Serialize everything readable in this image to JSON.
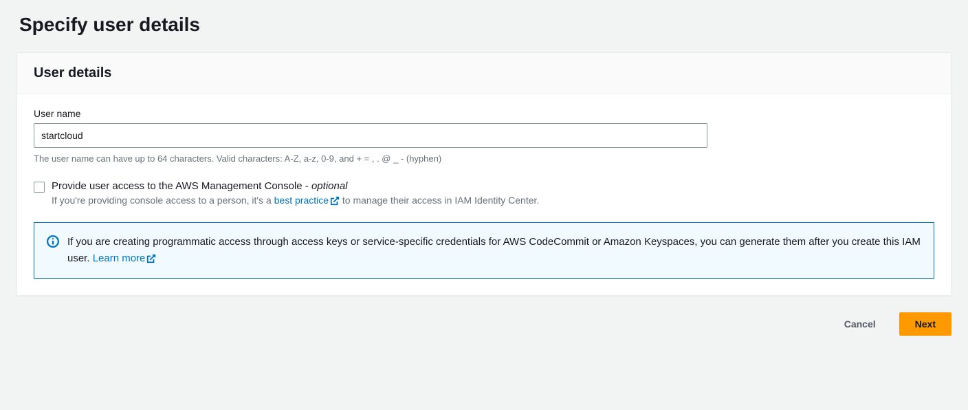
{
  "page": {
    "title": "Specify user details"
  },
  "panel": {
    "heading": "User details"
  },
  "username": {
    "label": "User name",
    "value": "startcloud",
    "hint": "The user name can have up to 64 characters. Valid characters: A-Z, a-z, 0-9, and + = , . @ _ - (hyphen)"
  },
  "console_access": {
    "label_main": "Provide user access to the AWS Management Console - ",
    "label_optional": "optional",
    "desc_prefix": "If you're providing console access to a person, it's a ",
    "desc_link": "best practice",
    "desc_suffix": " to manage their access in IAM Identity Center."
  },
  "info": {
    "text_prefix": "If you are creating programmatic access through access keys or service-specific credentials for AWS CodeCommit or Amazon Keyspaces, you can generate them after you create this IAM user. ",
    "learn_more": "Learn more"
  },
  "actions": {
    "cancel": "Cancel",
    "next": "Next"
  }
}
